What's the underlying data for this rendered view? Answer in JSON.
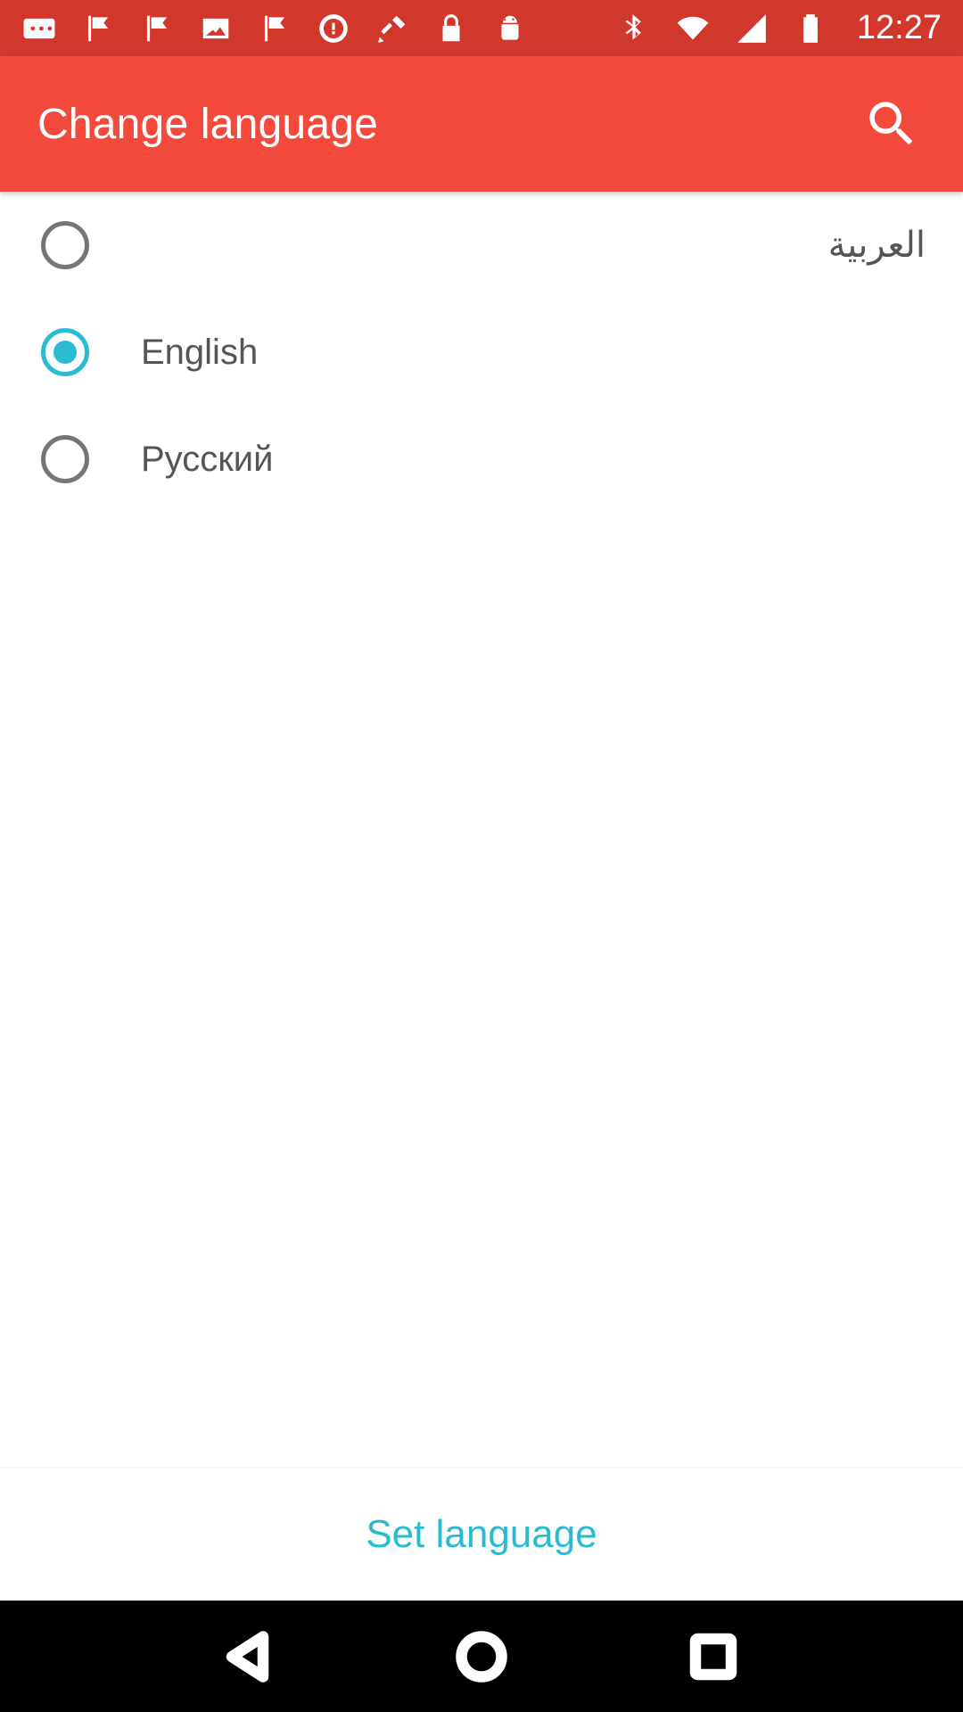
{
  "status_bar": {
    "time": "12:27",
    "left_icons": [
      "messages-icon",
      "flag-icon",
      "flag-icon",
      "image-icon",
      "flag-icon",
      "sync-icon",
      "fake-gps-icon",
      "lock-icon",
      "android-icon"
    ],
    "right_icons": [
      "bluetooth-icon",
      "wifi-icon",
      "signal-icon",
      "battery-icon"
    ]
  },
  "app_bar": {
    "title": "Change language",
    "search_icon": "search-icon",
    "background": "#f44a3e"
  },
  "languages": [
    {
      "label": "العربية",
      "selected": false
    },
    {
      "label": "English",
      "selected": true
    },
    {
      "label": "Русский",
      "selected": false
    }
  ],
  "footer": {
    "set_language_label": "Set language",
    "accent": "#2bbbd0"
  },
  "nav_bar": {
    "buttons": [
      "back-icon",
      "home-icon",
      "recents-icon"
    ]
  }
}
